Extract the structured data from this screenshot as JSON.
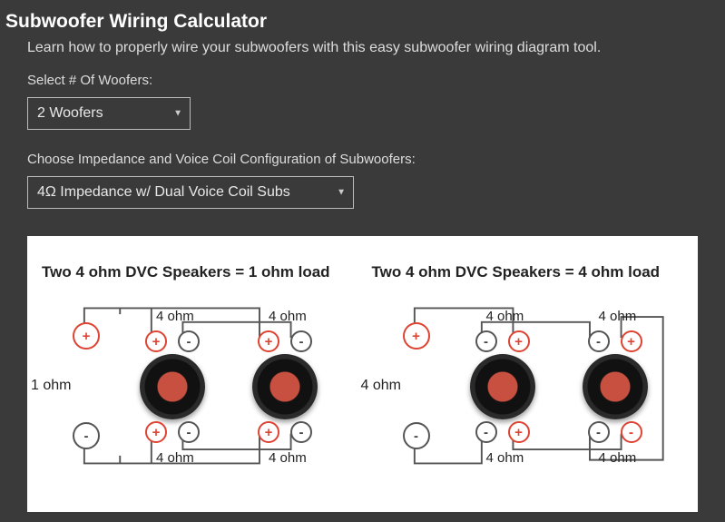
{
  "title": "Subwoofer Wiring Calculator",
  "intro": "Learn how to properly wire your subwoofers with this easy subwoofer wiring diagram tool.",
  "woofers": {
    "label": "Select # Of Woofers:",
    "value": "2 Woofers"
  },
  "impedance": {
    "label": "Choose Impedance and Voice Coil Configuration of Subwoofers:",
    "value": "4Ω Impedance w/ Dual Voice Coil Subs"
  },
  "diagrams": {
    "left": {
      "title": "Two 4 ohm DVC Speakers = 1 ohm load",
      "load": "1 ohm",
      "sp1_top": "4 ohm",
      "sp1_bot": "4 ohm",
      "sp2_top": "4 ohm",
      "sp2_bot": "4 ohm"
    },
    "right": {
      "title": "Two 4 ohm DVC Speakers = 4 ohm load",
      "load": "4 ohm",
      "sp1_top": "4 ohm",
      "sp1_bot": "4 ohm",
      "sp2_top": "4 ohm",
      "sp2_bot": "4 ohm"
    }
  }
}
